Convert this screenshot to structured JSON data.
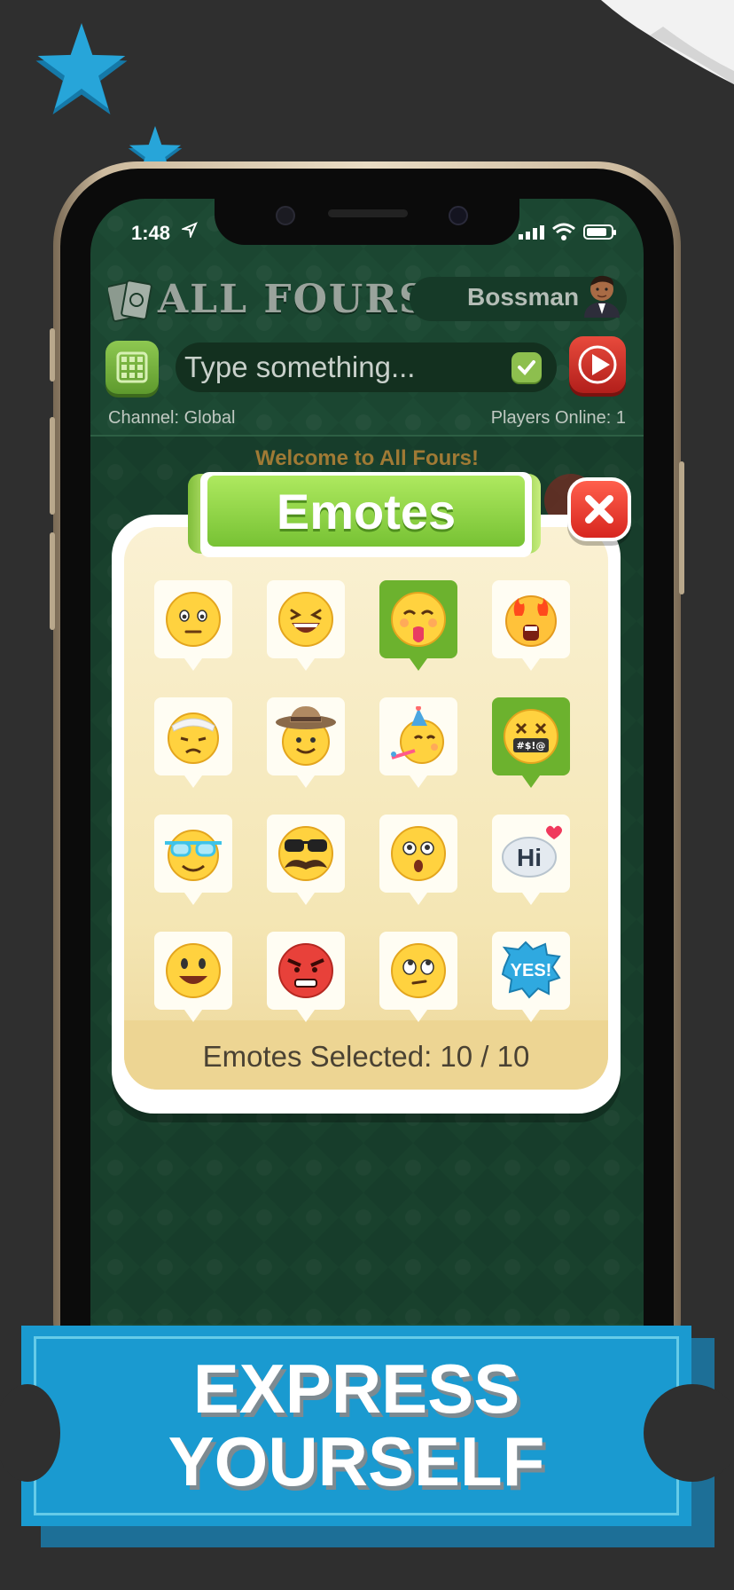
{
  "status_bar": {
    "time": "1:48"
  },
  "app": {
    "title": "ALL FOURS",
    "username": "Bossman"
  },
  "chat": {
    "placeholder": "Type something...",
    "channel": "Channel: Global",
    "players_online": "Players Online: 1",
    "welcome": "Welcome to All Fours!"
  },
  "emotes_modal": {
    "title": "Emotes",
    "selected_count": "Emotes Selected: 10 / 10",
    "emotes": [
      {
        "icon": "neutral-face-icon",
        "selected": false
      },
      {
        "icon": "laughing-face-icon",
        "selected": false
      },
      {
        "icon": "tongue-out-face-icon",
        "selected": true
      },
      {
        "icon": "fire-eyes-face-icon",
        "selected": false
      },
      {
        "icon": "bandaged-face-icon",
        "selected": false
      },
      {
        "icon": "hat-face-icon",
        "selected": false
      },
      {
        "icon": "party-face-icon",
        "selected": false
      },
      {
        "icon": "cursing-face-icon",
        "selected": true,
        "text": "#$!@"
      },
      {
        "icon": "sunglasses-face-icon",
        "selected": false
      },
      {
        "icon": "mustache-face-icon",
        "selected": false
      },
      {
        "icon": "surprised-face-icon",
        "selected": false
      },
      {
        "icon": "hi-bubble-icon",
        "selected": false,
        "text": "Hi"
      },
      {
        "icon": "smile-face-icon",
        "selected": false
      },
      {
        "icon": "angry-face-icon",
        "selected": false
      },
      {
        "icon": "eye-roll-face-icon",
        "selected": false
      },
      {
        "icon": "yes-burst-icon",
        "selected": false,
        "text": "YES!"
      }
    ]
  },
  "banner": {
    "line1": "EXPRESS",
    "line2": "YOURSELF"
  },
  "colors": {
    "felt": "#1d4a34",
    "banner": "#1a9ad0",
    "accent_green": "#77c234",
    "close_red": "#d7261f"
  }
}
